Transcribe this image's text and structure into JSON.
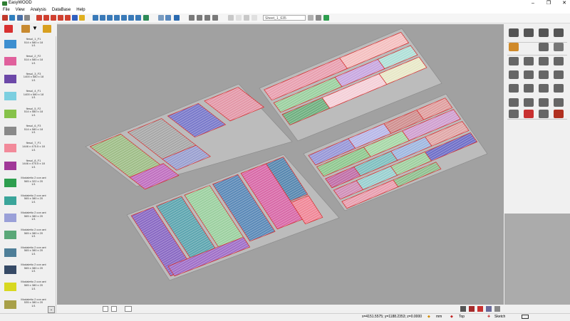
{
  "app": {
    "title": "EasyWOOD"
  },
  "menu": [
    "File",
    "View",
    "Analysis",
    "DataBase",
    "Help"
  ],
  "toolbar": {
    "sheet_selector": "Sheet_1_635"
  },
  "panels": [
    {
      "name": "fiesol_1_F1",
      "dims": "514 x 580 x 18",
      "qty": "1/1",
      "color": "#3d8fd0"
    },
    {
      "name": "fiesol_2_F2",
      "dims": "514 x 580 x 18",
      "qty": "1/1",
      "color": "#e0609c"
    },
    {
      "name": "fiesol_3_F3",
      "dims": "1400 x 580 x 18",
      "qty": "1/1",
      "color": "#6c48a8"
    },
    {
      "name": "fiesol_4_F1",
      "dims": "1400 x 580 x 18",
      "qty": "1/1",
      "color": "#7ccfe0"
    },
    {
      "name": "fiesol_5_F2",
      "dims": "514 x 580 x 18",
      "qty": "1/1",
      "color": "#86c24a"
    },
    {
      "name": "fiesol_6_F3",
      "dims": "514 x 580 x 18",
      "qty": "1/1",
      "color": "#8a8a8a"
    },
    {
      "name": "fiesol_7_F1",
      "dims": "1446 x 475.5 x 18",
      "qty": "1/1",
      "color": "#f28a9a"
    },
    {
      "name": "fiesol_8_F1",
      "dims": "1446 x 475.5 x 18",
      "qty": "1/1",
      "color": "#a03898"
    },
    {
      "name": "Modaletto 2 con ant",
      "dims": "565 x 322 x 20",
      "qty": "1/1",
      "color": "#2d9e4e"
    },
    {
      "name": "Modaletto 2 con ant",
      "dims": "565 x 380 x 20",
      "qty": "1/1",
      "color": "#3aa59a"
    },
    {
      "name": "Modaletto 2 con ant",
      "dims": "565 x 380 x 20",
      "qty": "1/1",
      "color": "#9aa0d8"
    },
    {
      "name": "Modaletto 2 con ant",
      "dims": "565 x 380 x 20",
      "qty": "1/1",
      "color": "#5aa878"
    },
    {
      "name": "Modaletto 2 con ant",
      "dims": "565 x 380 x 20",
      "qty": "1/1",
      "color": "#4e7e98"
    },
    {
      "name": "Modaletto 2 con ant",
      "dims": "565 x 380 x 20",
      "qty": "1/1",
      "color": "#364a66"
    },
    {
      "name": "Modaletto 2 con ant",
      "dims": "565 x 380 x 20",
      "qty": "1/1",
      "color": "#d8d820"
    },
    {
      "name": "Modaletto 2 con ant",
      "dims": "535 x 380 x 20",
      "qty": "1/1",
      "color": "#a8a048"
    }
  ],
  "status": {
    "coords": "x=4151.5575; y=1188.2353; z=0.0000",
    "units": "mm",
    "view": "Top",
    "mode": "Sketch"
  }
}
